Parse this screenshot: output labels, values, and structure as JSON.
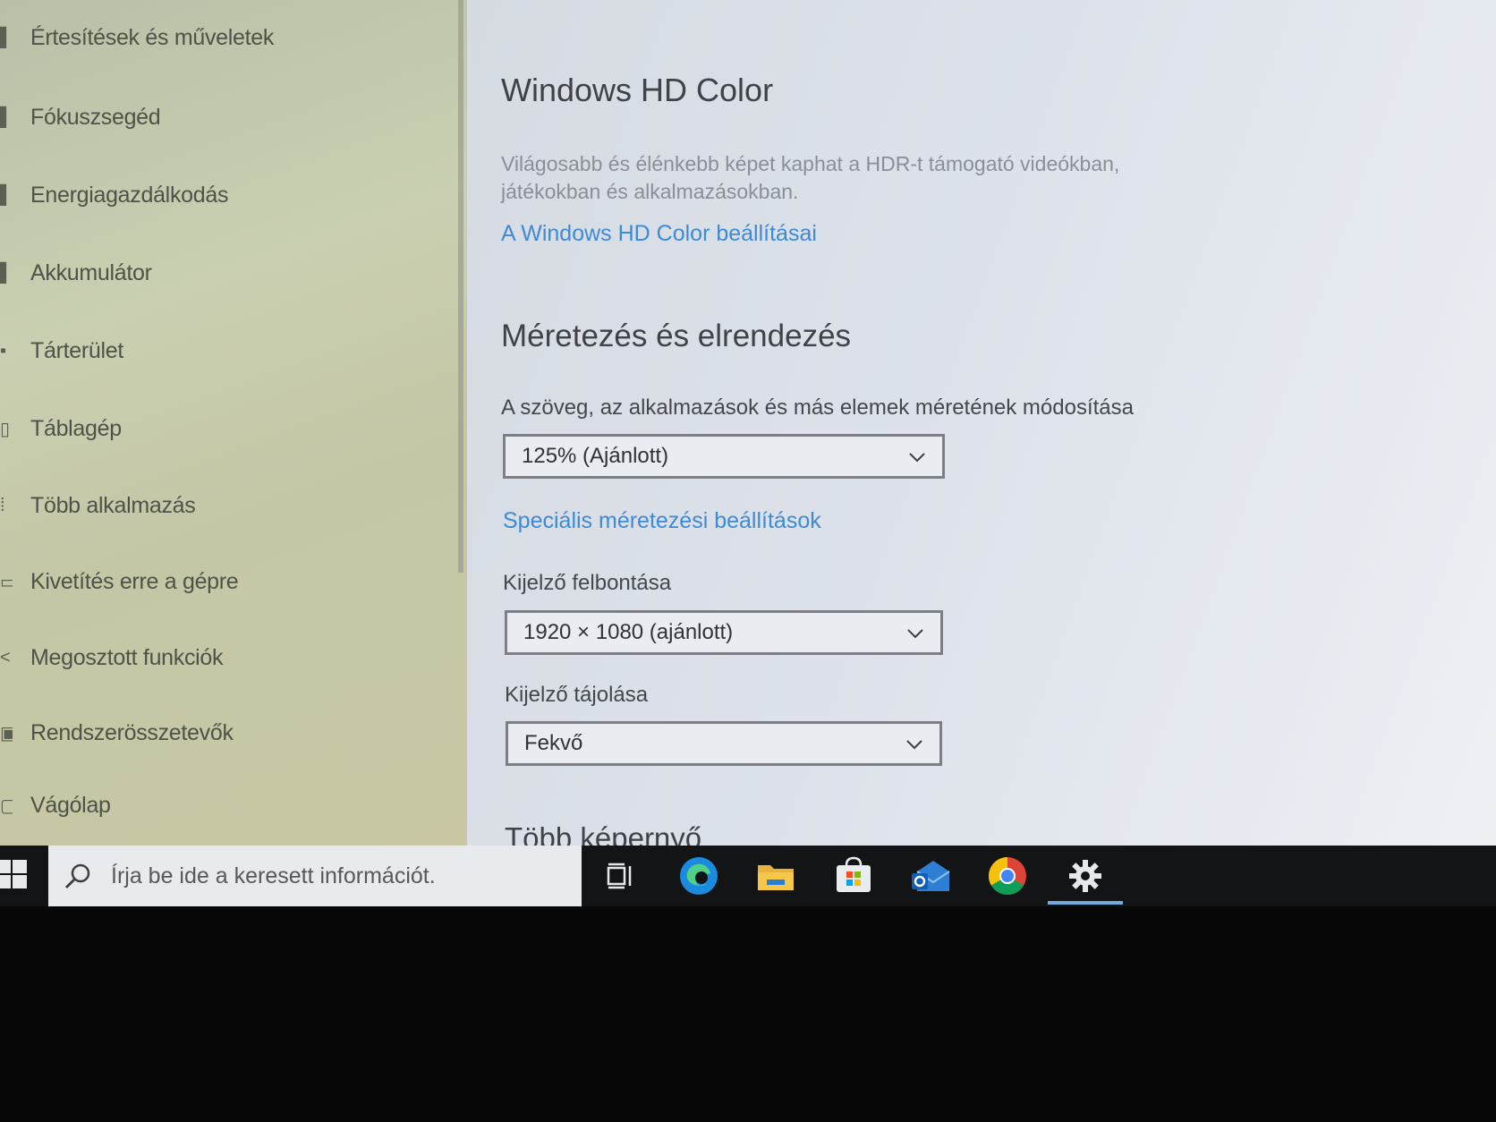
{
  "sidebar": {
    "items": [
      {
        "label": "Értesítések és műveletek",
        "icon": "notification-icon"
      },
      {
        "label": "Fókuszsegéd",
        "icon": "moon-icon"
      },
      {
        "label": "Energiagazdálkodás",
        "icon": "power-icon"
      },
      {
        "label": "Akkumulátor",
        "icon": "battery-icon"
      },
      {
        "label": "Tárterület",
        "icon": "storage-icon"
      },
      {
        "label": "Táblagép",
        "icon": "tablet-icon"
      },
      {
        "label": "Több alkalmazás",
        "icon": "multitasking-icon"
      },
      {
        "label": "Kivetítés erre a gépre",
        "icon": "projecting-icon"
      },
      {
        "label": "Megosztott funkciók",
        "icon": "shared-icon"
      },
      {
        "label": "Rendszerösszetevők",
        "icon": "components-icon"
      },
      {
        "label": "Vágólap",
        "icon": "clipboard-icon"
      }
    ]
  },
  "hdr": {
    "title": "Windows HD Color",
    "description": "Világosabb és élénkebb képet kaphat a HDR-t támogató videókban, játékokban és alkalmazásokban.",
    "link": "A Windows HD Color beállításai"
  },
  "scale": {
    "title": "Méretezés és elrendezés",
    "size_label": "A szöveg, az alkalmazások és más elemek méretének módosítása",
    "size_value": "125% (Ajánlott)",
    "advanced_link": "Speciális méretezési beállítások",
    "resolution_label": "Kijelző felbontása",
    "resolution_value": "1920 × 1080 (ajánlott)",
    "orientation_label": "Kijelző tájolása",
    "orientation_value": "Fekvő"
  },
  "multi": {
    "title": "Több képernyő"
  },
  "taskbar": {
    "search_placeholder": "Írja be ide a keresett információt.",
    "apps": [
      "task-view-icon",
      "edge-icon",
      "file-explorer-icon",
      "store-icon",
      "outlook-icon",
      "chrome-icon",
      "settings-icon"
    ]
  },
  "colors": {
    "accent": "#3d8ad6",
    "taskbar": "#121416"
  }
}
